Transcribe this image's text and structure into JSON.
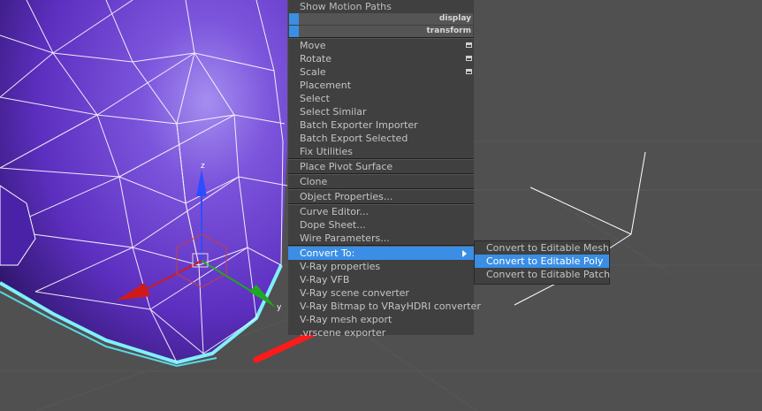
{
  "quad_menu": {
    "top_item": "Show Motion Paths",
    "display_header": "display",
    "transform_header": "transform",
    "transform_items": [
      "Move",
      "Rotate",
      "Scale",
      "Placement",
      "Select",
      "Select Similar",
      "Batch Exporter Importer",
      "Batch Export Selected",
      "Fix Utilities"
    ],
    "place_pivot": "Place Pivot Surface",
    "clone": "Clone",
    "object_properties": "Object Properties...",
    "editors": [
      "Curve Editor...",
      "Dope Sheet...",
      "Wire Parameters..."
    ],
    "convert_to": "Convert To:",
    "vray_items": [
      "V-Ray properties",
      "V-Ray VFB",
      "V-Ray scene converter",
      "V-Ray Bitmap to VRayHDRI converter",
      "V-Ray mesh export",
      ".vrscene exporter"
    ]
  },
  "submenu": {
    "items": [
      "Convert to Editable Mesh",
      "Convert to Editable Poly",
      "Convert to Editable Patch"
    ],
    "highlighted_index": 1
  },
  "gizmo": {
    "z_label": "z",
    "y_label": "y"
  },
  "colors": {
    "viewport_bg": "#505050",
    "object": "#6a3fc4",
    "menu_bg": "#404040",
    "highlight": "#3a8ee6",
    "annotation_arrow": "#ff1a1a"
  }
}
